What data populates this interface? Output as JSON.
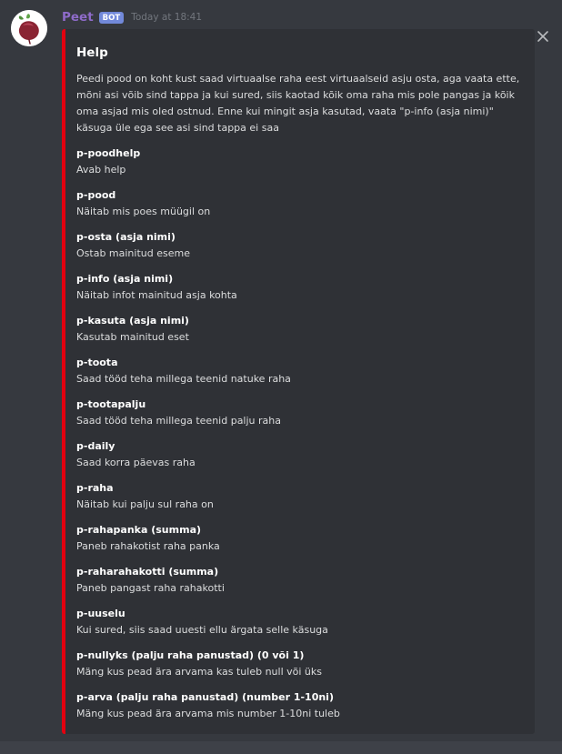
{
  "author": {
    "username": "Peet",
    "bot_tag": "BOT",
    "timestamp": "Today at 18:41",
    "avatar_icon": "beet-icon"
  },
  "embed": {
    "accent_color": "#e3000f",
    "title": "Help",
    "description": "Peedi pood on koht kust saad virtuaalse raha eest virtuaalseid asju osta, aga vaata ette, mõni asi võib sind tappa ja kui sured, siis kaotad kõik oma raha mis pole pangas ja kõik oma asjad mis oled ostnud. Enne kui mingit asja kasutad, vaata \"p-info (asja nimi)\" käsuga üle ega see asi sind tappa ei saa",
    "fields": [
      {
        "name": "p-poodhelp",
        "value": "Avab help"
      },
      {
        "name": "p-pood",
        "value": "Näitab mis poes müügil on"
      },
      {
        "name": "p-osta (asja nimi)",
        "value": "Ostab mainitud eseme"
      },
      {
        "name": "p-info (asja nimi)",
        "value": "Näitab infot mainitud asja kohta"
      },
      {
        "name": "p-kasuta (asja nimi)",
        "value": "Kasutab mainitud eset"
      },
      {
        "name": "p-toota",
        "value": "Saad tööd teha millega teenid natuke raha"
      },
      {
        "name": "p-tootapalju",
        "value": "Saad tööd teha millega teenid palju raha"
      },
      {
        "name": "p-daily",
        "value": "Saad korra päevas raha"
      },
      {
        "name": "p-raha",
        "value": "Näitab kui palju sul raha on"
      },
      {
        "name": "p-rahapanka (summa)",
        "value": "Paneb rahakotist raha panka"
      },
      {
        "name": "p-raharahakotti (summa)",
        "value": "Paneb pangast raha rahakotti"
      },
      {
        "name": "p-uuselu",
        "value": "Kui sured, siis saad uuesti ellu ärgata selle käsuga"
      },
      {
        "name": "p-nullyks (palju raha panustad) (0 või 1)",
        "value": "Mäng kus pead ära arvama kas tuleb null või üks"
      },
      {
        "name": "p-arva (palju raha panustad) (number 1-10ni)",
        "value": "Mäng kus pead ära arvama mis number 1-10ni tuleb"
      }
    ]
  },
  "close_icon": "close-icon"
}
